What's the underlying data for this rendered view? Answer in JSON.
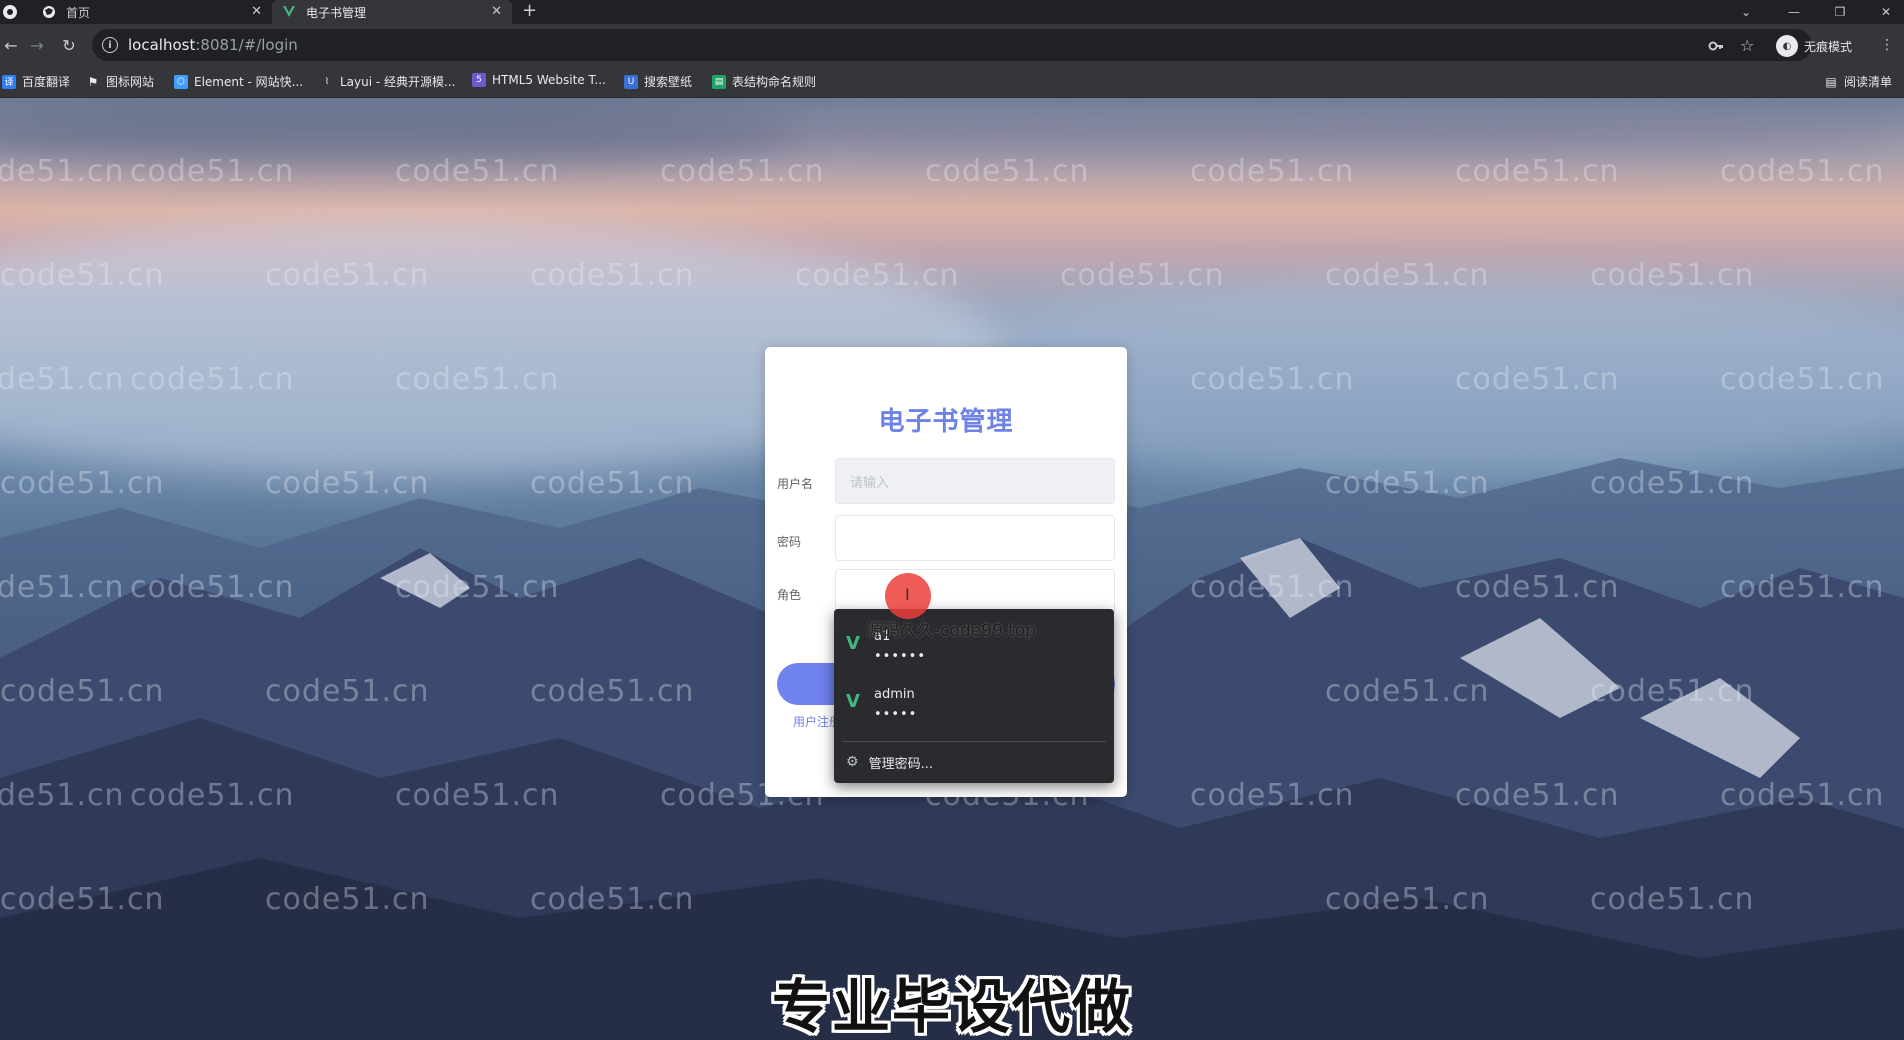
{
  "browser": {
    "tabs": [
      {
        "label": "首页",
        "icon": "globe-icon"
      },
      {
        "label": "电子书管理",
        "icon": "vue-logo-icon"
      }
    ],
    "url_host": "localhost",
    "url_path": ":8081/#/login",
    "incognito_label": "无痕模式",
    "bookmarks": [
      {
        "label": "百度翻译",
        "icon": "baidu-translate-icon"
      },
      {
        "label": "图标网站",
        "icon": "flag-icon"
      },
      {
        "label": "Element - 网站快...",
        "icon": "element-icon"
      },
      {
        "label": "Layui - 经典开源模...",
        "icon": "layui-icon"
      },
      {
        "label": "HTML5 Website T...",
        "icon": "html5-icon"
      },
      {
        "label": "搜索壁纸",
        "icon": "wallpaper-icon"
      },
      {
        "label": "表结构命名规则",
        "icon": "sheet-icon"
      }
    ],
    "reading_list_label": "阅读清单"
  },
  "login": {
    "title": "电子书管理",
    "username_label": "用户名",
    "username_placeholder": "请输入",
    "password_label": "密码",
    "role_label": "角色",
    "login_button": "login",
    "register_link": "用户注册"
  },
  "autofill": {
    "overlay_text": "源码久久-code99.top",
    "entries": [
      {
        "username": "a1",
        "password_mask": "••••••"
      },
      {
        "username": "admin",
        "password_mask": "•••••"
      }
    ],
    "manage_label": "管理密码..."
  },
  "watermark_text": "code51.cn",
  "subtitle": "专业毕设代做",
  "colors": {
    "title_accent": "#6f82e8",
    "button": "#6f82f0",
    "autofill_bg": "#2a2b2e",
    "vue_green": "#41b883"
  }
}
